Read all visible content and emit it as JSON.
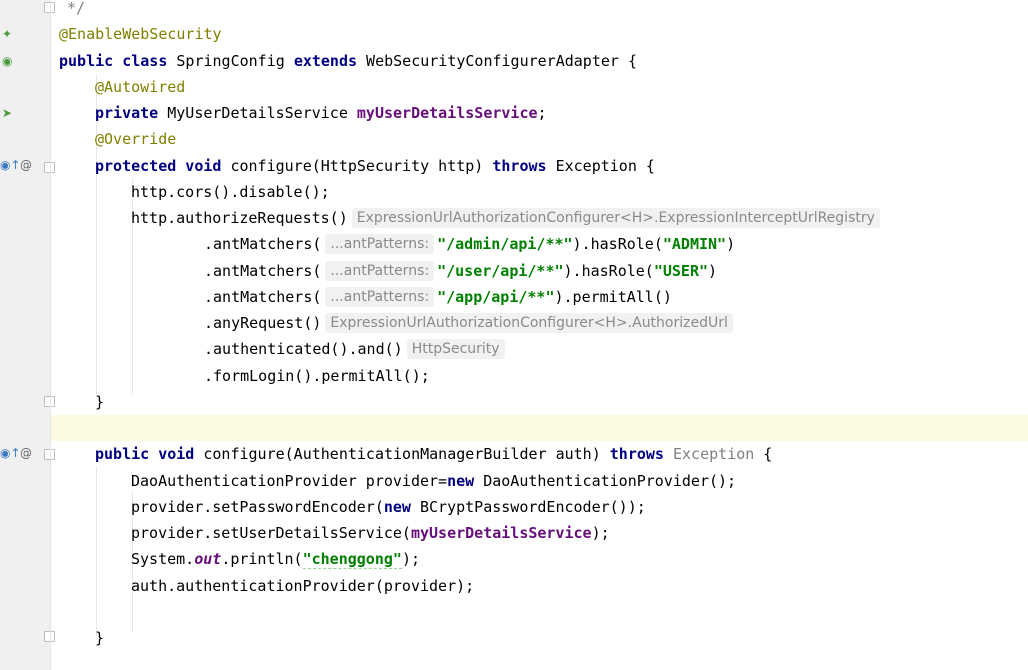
{
  "lines": {
    "l0": "*/",
    "l1_ann": "@EnableWebSecurity",
    "l2_kw1": "public class",
    "l2_name": " SpringConfig ",
    "l2_kw2": "extends",
    "l2_rest": " WebSecurityConfigurerAdapter {",
    "l3_ann": "@Autowired",
    "l4_kw": "private",
    "l4_type": " MyUserDetailsService ",
    "l4_field": "myUserDetailsService",
    "l4_end": ";",
    "l5_ann": "@Override",
    "l6_kw": "protected void",
    "l6_mid": " configure(HttpSecurity http) ",
    "l6_throws": "throws",
    "l6_rest": " Exception {",
    "l7": "http.cors().disable();",
    "l8_code": "http.authorizeRequests()",
    "l8_hint": "ExpressionUrlAuthorizationConfigurer<H>.ExpressionInterceptUrlRegistry",
    "l9_pre": ".antMatchers(",
    "l9_hint": "...antPatterns:",
    "l9_str": "\"/admin/api/**\"",
    "l9_mid": ").hasRole(",
    "l9_str2": "\"ADMIN\"",
    "l9_end": ")",
    "l10_pre": ".antMatchers(",
    "l10_hint": "...antPatterns:",
    "l10_str": "\"/user/api/**\"",
    "l10_mid": ").hasRole(",
    "l10_str2": "\"USER\"",
    "l10_end": ")",
    "l11_pre": ".antMatchers(",
    "l11_hint": "...antPatterns:",
    "l11_str": "\"/app/api/**\"",
    "l11_end": ").permitAll()",
    "l12_code": ".anyRequest()",
    "l12_hint": "ExpressionUrlAuthorizationConfigurer<H>.AuthorizedUrl",
    "l13_code": ".authenticated().and()",
    "l13_hint": "HttpSecurity",
    "l14": ".formLogin().permitAll();",
    "l15": "}",
    "l17_kw": "public void",
    "l17_mid": " configure(AuthenticationManagerBuilder auth) ",
    "l17_throws": "throws",
    "l17_exc": " Exception",
    "l17_end": " {",
    "l18_pre": "DaoAuthenticationProvider provider=",
    "l18_kw": "new",
    "l18_rest": " DaoAuthenticationProvider();",
    "l19_pre": "provider.setPasswordEncoder(",
    "l19_kw": "new",
    "l19_rest": " BCryptPasswordEncoder());",
    "l20_pre": "provider.setUserDetailsService(",
    "l20_field": "myUserDetailsService",
    "l20_end": ");",
    "l21_pre": "System.",
    "l21_static": "out",
    "l21_mid": ".println(",
    "l21_str": "\"chenggong\"",
    "l21_end": ");",
    "l22": "auth.authenticationProvider(provider);",
    "l24": "}"
  },
  "gutter_icons": {
    "bean": "spring-bean-icon",
    "autowire": "autowired-icon",
    "override": "override-method-icon",
    "annotation_marker": "@"
  },
  "colors": {
    "keyword": "#000080",
    "annotation": "#808000",
    "string": "#008000",
    "field": "#660e7a",
    "current_line": "#fcfae3",
    "gutter": "#f0f0f0"
  }
}
